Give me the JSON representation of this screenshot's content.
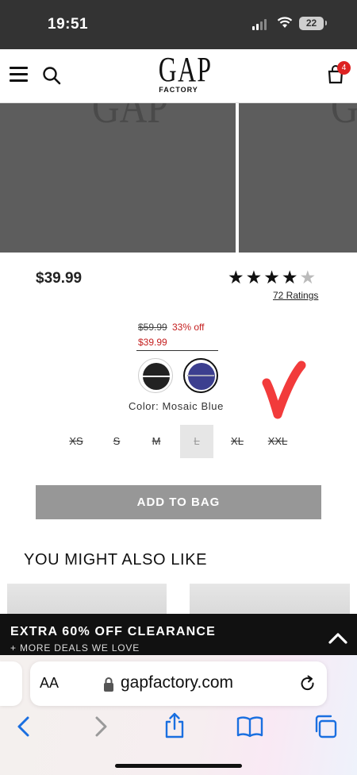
{
  "status_bar": {
    "time": "19:51",
    "battery": "22"
  },
  "header": {
    "logo_text": "GAP",
    "logo_subtext": "FACTORY",
    "bag_count": "4"
  },
  "product": {
    "price": "$39.99",
    "rating": 4.5,
    "ratings_link": "72 Ratings",
    "original_price": "$59.99",
    "discount": "33% off",
    "sale_price": "$39.99",
    "color_label": "Color: Mosaic Blue",
    "swatch_colors": [
      "#222222",
      "#3c3f8f"
    ],
    "sizes": [
      "XS",
      "S",
      "M",
      "L",
      "XL",
      "XXL"
    ],
    "selected_size": "L",
    "add_to_bag": "ADD TO BAG"
  },
  "recommendations": {
    "heading": "YOU MIGHT ALSO LIKE"
  },
  "promo_banner": {
    "title": "EXTRA 60% OFF CLEARANCE",
    "subtitle": "+ MORE DEALS WE LOVE"
  },
  "browser": {
    "text_size_label": "AA",
    "url": "gapfactory.com"
  },
  "colors": {
    "sale_red": "#c41e1e",
    "promo_black": "#111111",
    "accent_blue": "#1a6fe0",
    "button_gray": "#979797"
  }
}
